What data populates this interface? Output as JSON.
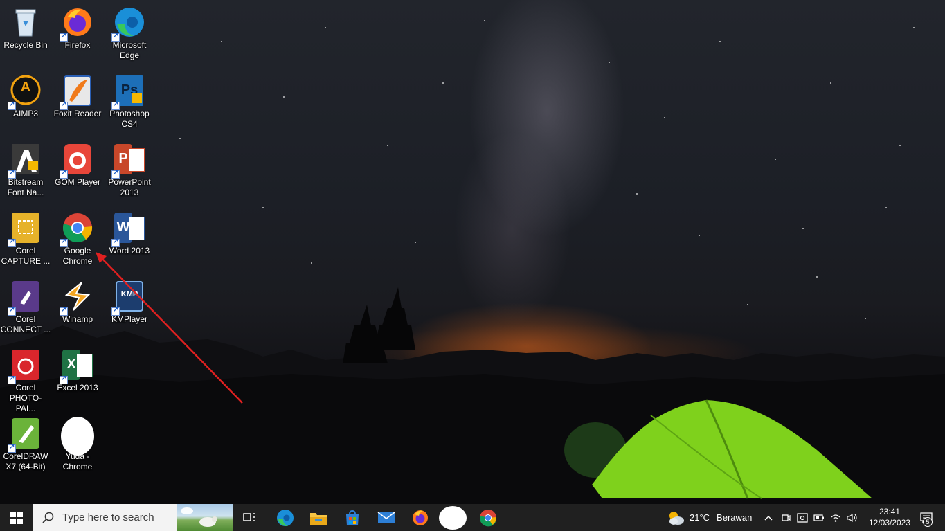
{
  "desktop": {
    "icons": [
      {
        "label": "Recycle Bin",
        "icon": "recycle-bin-icon"
      },
      {
        "label": "Firefox",
        "icon": "firefox-icon"
      },
      {
        "label": "Microsoft\nEdge",
        "icon": "edge-icon"
      },
      {
        "label": "AIMP3",
        "icon": "aimp-icon"
      },
      {
        "label": "Foxit Reader",
        "icon": "foxit-reader-icon"
      },
      {
        "label": "Photoshop\nCS4",
        "icon": "photoshop-icon"
      },
      {
        "label": "Bitstream\nFont Na...",
        "icon": "bitstream-font-icon"
      },
      {
        "label": "GOM Player",
        "icon": "gom-player-icon"
      },
      {
        "label": "PowerPoint\n2013",
        "icon": "powerpoint-icon"
      },
      {
        "label": "Corel\nCAPTURE ...",
        "icon": "corel-capture-icon"
      },
      {
        "label": "Google\nChrome",
        "icon": "chrome-icon"
      },
      {
        "label": "Word 2013",
        "icon": "word-icon"
      },
      {
        "label": "Corel\nCONNECT ...",
        "icon": "corel-connect-icon"
      },
      {
        "label": "Winamp",
        "icon": "winamp-icon"
      },
      {
        "label": "KMPlayer",
        "icon": "kmplayer-icon"
      },
      {
        "label": "Corel\nPHOTO-PAI...",
        "icon": "corel-photo-paint-icon"
      },
      {
        "label": "Excel 2013",
        "icon": "excel-icon"
      },
      {
        "label": "CorelDRAW\nX7 (64-Bit)",
        "icon": "coreldraw-icon"
      },
      {
        "label": "Yuda -\nChrome",
        "icon": "chrome-profile-icon"
      }
    ],
    "tile_text": {
      "aimp": "A",
      "photoshop": "Ps",
      "powerpoint": "P",
      "word": "W",
      "excel": "X",
      "kmplayer": "KMP"
    }
  },
  "taskbar": {
    "search_placeholder": "Type here to search",
    "pinned": [
      "task-view-icon",
      "edge-icon",
      "file-explorer-icon",
      "microsoft-store-icon",
      "mail-icon",
      "firefox-icon",
      "chrome-profile-icon",
      "chrome-icon"
    ],
    "weather": {
      "temperature": "21°C",
      "condition": "Berawan"
    },
    "clock": {
      "time": "23:41",
      "date": "12/03/2023"
    },
    "notification_count": "5"
  },
  "colors": {
    "taskbar_bg": "#202020",
    "annotation_arrow": "#e02020"
  }
}
